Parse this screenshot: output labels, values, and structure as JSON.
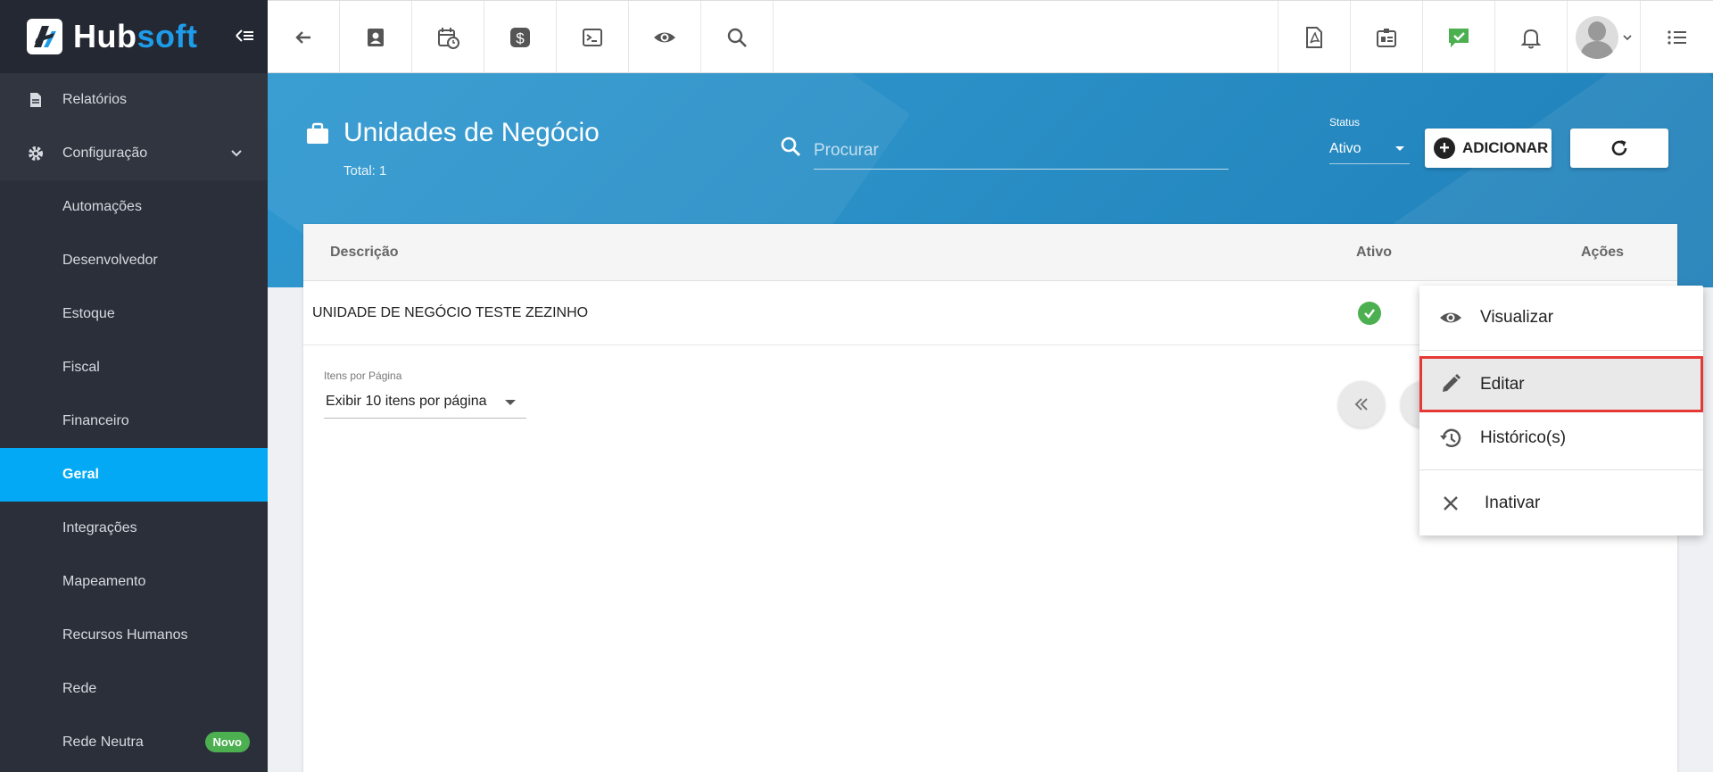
{
  "app": {
    "name_part1": "Hub",
    "name_part2": "soft"
  },
  "sidebar": {
    "items": [
      {
        "label": "Relatórios"
      },
      {
        "label": "Configuração"
      },
      {
        "label": "Automações"
      },
      {
        "label": "Desenvolvedor"
      },
      {
        "label": "Estoque"
      },
      {
        "label": "Fiscal"
      },
      {
        "label": "Financeiro"
      },
      {
        "label": "Geral"
      },
      {
        "label": "Integrações"
      },
      {
        "label": "Mapeamento"
      },
      {
        "label": "Recursos Humanos"
      },
      {
        "label": "Rede"
      },
      {
        "label": "Rede Neutra",
        "badge": "Novo"
      }
    ]
  },
  "header": {
    "title": "Unidades de Negócio",
    "total": "Total: 1",
    "search_placeholder": "Procurar",
    "status_label": "Status",
    "status_value": "Ativo",
    "add_label": "ADICIONAR"
  },
  "table": {
    "columns": [
      "Descrição",
      "Ativo",
      "Ações"
    ],
    "rows": [
      {
        "descricao": "UNIDADE DE NEGÓCIO TESTE ZEZINHO"
      }
    ],
    "per_page_label": "Itens por Página",
    "per_page_value": "Exibir 10 itens por página"
  },
  "context_menu": {
    "items": [
      {
        "label": "Visualizar",
        "icon": "eye-icon"
      },
      {
        "label": "Editar",
        "icon": "pencil-icon",
        "selected": true
      },
      {
        "label": "Histórico(s)",
        "icon": "history-icon"
      },
      {
        "label": "Inativar",
        "icon": "close-icon"
      }
    ]
  },
  "colors": {
    "sidebar_bg": "#2b2f3a",
    "active_item": "#03a9f4",
    "banner": "#2a8fc6",
    "success": "#4caf50",
    "highlight": "#e53935"
  }
}
